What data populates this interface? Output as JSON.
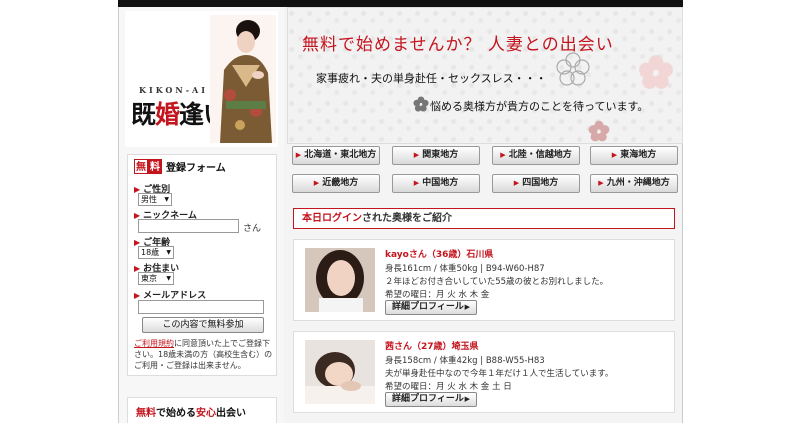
{
  "logo": {
    "sub": "KIKON-AI",
    "main_a": "既",
    "main_b": "婚",
    "main_c": "逢い"
  },
  "form": {
    "free_a": "無",
    "free_b": "料",
    "title": "登録フォーム",
    "gender_label": "ご性別",
    "gender_value": "男性",
    "nickname_label": "ニックネーム",
    "nickname_suffix": "さん",
    "age_label": "ご年齢",
    "age_value": "18歳",
    "area_label": "お住まい",
    "area_value": "東京",
    "email_label": "メールアドレス",
    "submit_label": "この内容で無料参加",
    "terms_link": "ご利用規約",
    "terms_text": "に同意頂いた上でご登録下さい。18歳未満の方（高校生含む）のご利用・ご登録は出来ません。"
  },
  "box2": {
    "a": "無料",
    "b": "で始める",
    "c": "安心",
    "d": "出会い"
  },
  "banner": {
    "headline": "無料で始めませんか？ 人妻との出会い",
    "line2": "家事疲れ・夫の単身赴任・セックスレス・・・",
    "line3": "悩める奥様方が貴方のことを待っています。"
  },
  "regions": [
    "北海道・東北地方",
    "関東地方",
    "北陸・信越地方",
    "東海地方",
    "近畿地方",
    "中国地方",
    "四国地方",
    "九州・沖縄地方"
  ],
  "today": {
    "red": "本日ログイン",
    "rest": "された奥様をご紹介"
  },
  "profiles": [
    {
      "name": "kayoさん（36歳）石川県",
      "body": "身長161cm / 体重50kg | B94-W60-H87",
      "desc": "２年ほどお付き合いしていた55歳の彼とお別れしました。",
      "days": "希望の曜日：月 火 水 木 金",
      "button": "詳細プロフィール"
    },
    {
      "name": "茜さん（27歳）埼玉県",
      "body": "身長158cm / 体重42kg | B88-W55-H83",
      "desc": "夫が単身赴任中なので今年１年だけ１人で生活しています。",
      "days": "希望の曜日：月 火 水 木 金 土 日",
      "button": "詳細プロフィール"
    }
  ],
  "colors": {
    "accent": "#c4141d",
    "topbar": "#111111"
  }
}
